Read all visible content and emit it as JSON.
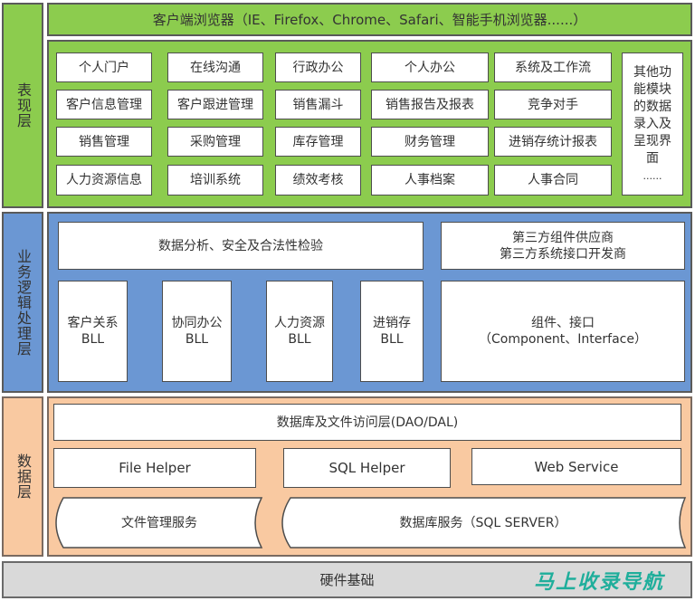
{
  "layers": {
    "presentation": {
      "label": "表现层",
      "browser_bar": "客户端浏览器（IE、Firefox、Chrome、Safari、智能手机浏览器......）",
      "modules": [
        [
          "个人门户",
          "在线沟通",
          "行政办公",
          "个人办公",
          "系统及工作流"
        ],
        [
          "客户信息管理",
          "客户跟进管理",
          "销售漏斗",
          "销售报告及报表",
          "竞争对手"
        ],
        [
          "销售管理",
          "采购管理",
          "库存管理",
          "财务管理",
          "进销存统计报表"
        ],
        [
          "人力资源信息",
          "培训系统",
          "绩效考核",
          "人事档案",
          "人事合同"
        ]
      ],
      "other_modules": [
        "其他功",
        "能模块",
        "的数据",
        "录入及",
        "呈现界",
        "面",
        "......"
      ]
    },
    "business": {
      "label": "业务逻辑处理层",
      "validation": "数据分析、安全及合法性检验",
      "third_party": [
        "第三方组件供应商",
        "第三方系统接口开发商"
      ],
      "bll_modules": [
        {
          "name": "客户关系",
          "suffix": "BLL"
        },
        {
          "name": "协同办公",
          "suffix": "BLL"
        },
        {
          "name": "人力资源",
          "suffix": "BLL"
        },
        {
          "name": "进销存",
          "suffix": "BLL"
        }
      ],
      "components": [
        "组件、接口",
        "（Component、Interface）"
      ]
    },
    "data": {
      "label": "数据层",
      "dao": "数据库及文件访问层(DAO/DAL)",
      "helpers": [
        "File Helper",
        "SQL Helper",
        "Web Service"
      ],
      "services": [
        "文件管理服务",
        "数据库服务（SQL SERVER）"
      ]
    },
    "hardware": {
      "label": "硬件基础"
    }
  },
  "watermark": "马上收录导航",
  "colors": {
    "presentation": "#8ccc4e",
    "business": "#6b97d3",
    "data": "#f9c9a1",
    "hardware": "#d9d9d9",
    "watermark": "#1fae9b"
  }
}
